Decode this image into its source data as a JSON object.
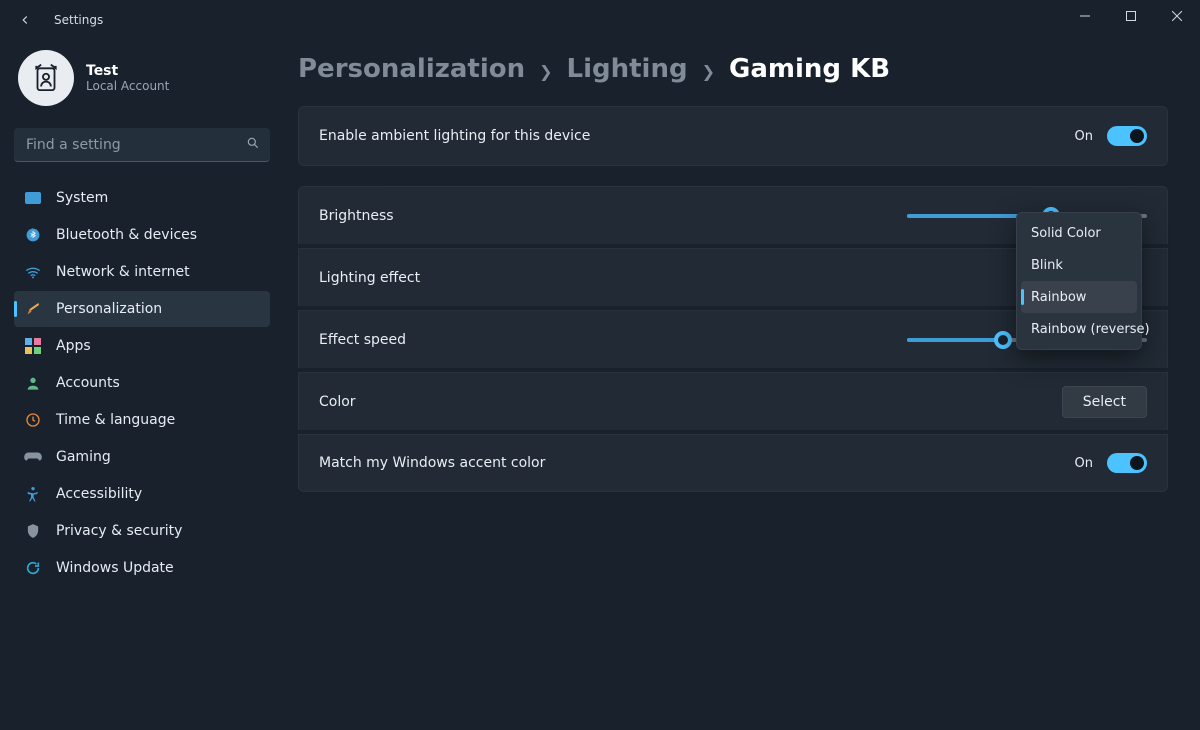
{
  "window": {
    "title": "Settings"
  },
  "profile": {
    "name": "Test",
    "subtitle": "Local Account"
  },
  "search": {
    "placeholder": "Find a setting"
  },
  "sidebar": {
    "items": [
      {
        "label": "System"
      },
      {
        "label": "Bluetooth & devices"
      },
      {
        "label": "Network & internet"
      },
      {
        "label": "Personalization"
      },
      {
        "label": "Apps"
      },
      {
        "label": "Accounts"
      },
      {
        "label": "Time & language"
      },
      {
        "label": "Gaming"
      },
      {
        "label": "Accessibility"
      },
      {
        "label": "Privacy & security"
      },
      {
        "label": "Windows Update"
      }
    ],
    "selected_index": 3
  },
  "breadcrumb": {
    "items": [
      "Personalization",
      "Lighting",
      "Gaming KB"
    ],
    "current_index": 2
  },
  "settings": {
    "enable_lighting": {
      "label": "Enable ambient lighting for this device",
      "state_label": "On",
      "on": true
    },
    "brightness": {
      "label": "Brightness",
      "value": 60
    },
    "lighting_effect": {
      "label": "Lighting effect"
    },
    "effect_speed": {
      "label": "Effect speed",
      "value": 40
    },
    "color": {
      "label": "Color",
      "button": "Select"
    },
    "match_accent": {
      "label": "Match my Windows accent color",
      "state_label": "On",
      "on": true
    }
  },
  "dropdown": {
    "options": [
      "Solid Color",
      "Blink",
      "Rainbow",
      "Rainbow (reverse)"
    ],
    "selected_index": 2
  },
  "colors": {
    "accent": "#4cc2ff"
  }
}
